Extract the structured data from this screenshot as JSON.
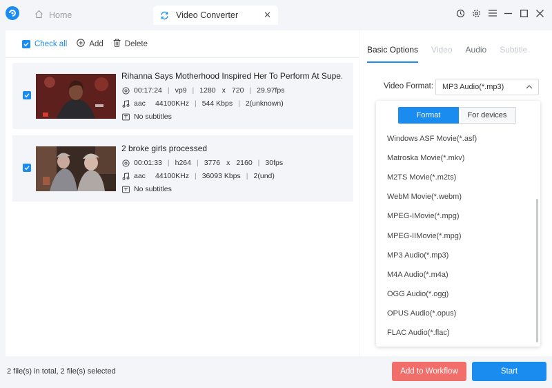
{
  "tabs": {
    "home": "Home",
    "video_converter": "Video Converter"
  },
  "toolbar": {
    "check_all": "Check all",
    "add": "Add",
    "delete": "Delete"
  },
  "files": [
    {
      "name": "Rihanna Says Motherhood Inspired Her To Perform At Supe...",
      "duration": "00:17:24",
      "vcodec": "vp9",
      "width": "1280",
      "x": "x",
      "height": "720",
      "fps": "29.97fps",
      "acodec": "aac",
      "samplerate": "44100KHz",
      "bitrate": "544 Kbps",
      "channels": "2(unknown)",
      "subtitles": "No subtitles"
    },
    {
      "name": "2 broke girls processed",
      "duration": "00:01:33",
      "vcodec": "h264",
      "width": "3776",
      "x": "x",
      "height": "2160",
      "fps": "30fps",
      "acodec": "aac",
      "samplerate": "44100KHz",
      "bitrate": "36093 Kbps",
      "channels": "2(und)",
      "subtitles": "No subtitles"
    }
  ],
  "right": {
    "tabs": [
      "Basic Options",
      "Video",
      "Audio",
      "Subtitle"
    ],
    "video_format_label": "Video Format:",
    "video_format_value": "MP3 Audio(*.mp3)"
  },
  "dropdown": {
    "tab_format": "Format",
    "tab_devices": "For devices",
    "items": [
      "Windows ASF Movie(*.asf)",
      "Matroska Movie(*.mkv)",
      "M2TS Movie(*.m2ts)",
      "WebM Movie(*.webm)",
      "MPEG-IMovie(*.mpg)",
      "MPEG-IIMovie(*.mpg)",
      "MP3 Audio(*.mp3)",
      "M4A Audio(*.m4a)",
      "OGG Audio(*.ogg)",
      "OPUS Audio(*.opus)",
      "FLAC Audio(*.flac)"
    ]
  },
  "footer": {
    "status": "2 file(s) in total, 2 file(s) selected",
    "add_to_workflow": "Add to Workflow",
    "start": "Start"
  },
  "colors": {
    "accent": "#1a8cf0",
    "workflow": "#f26e6a"
  }
}
